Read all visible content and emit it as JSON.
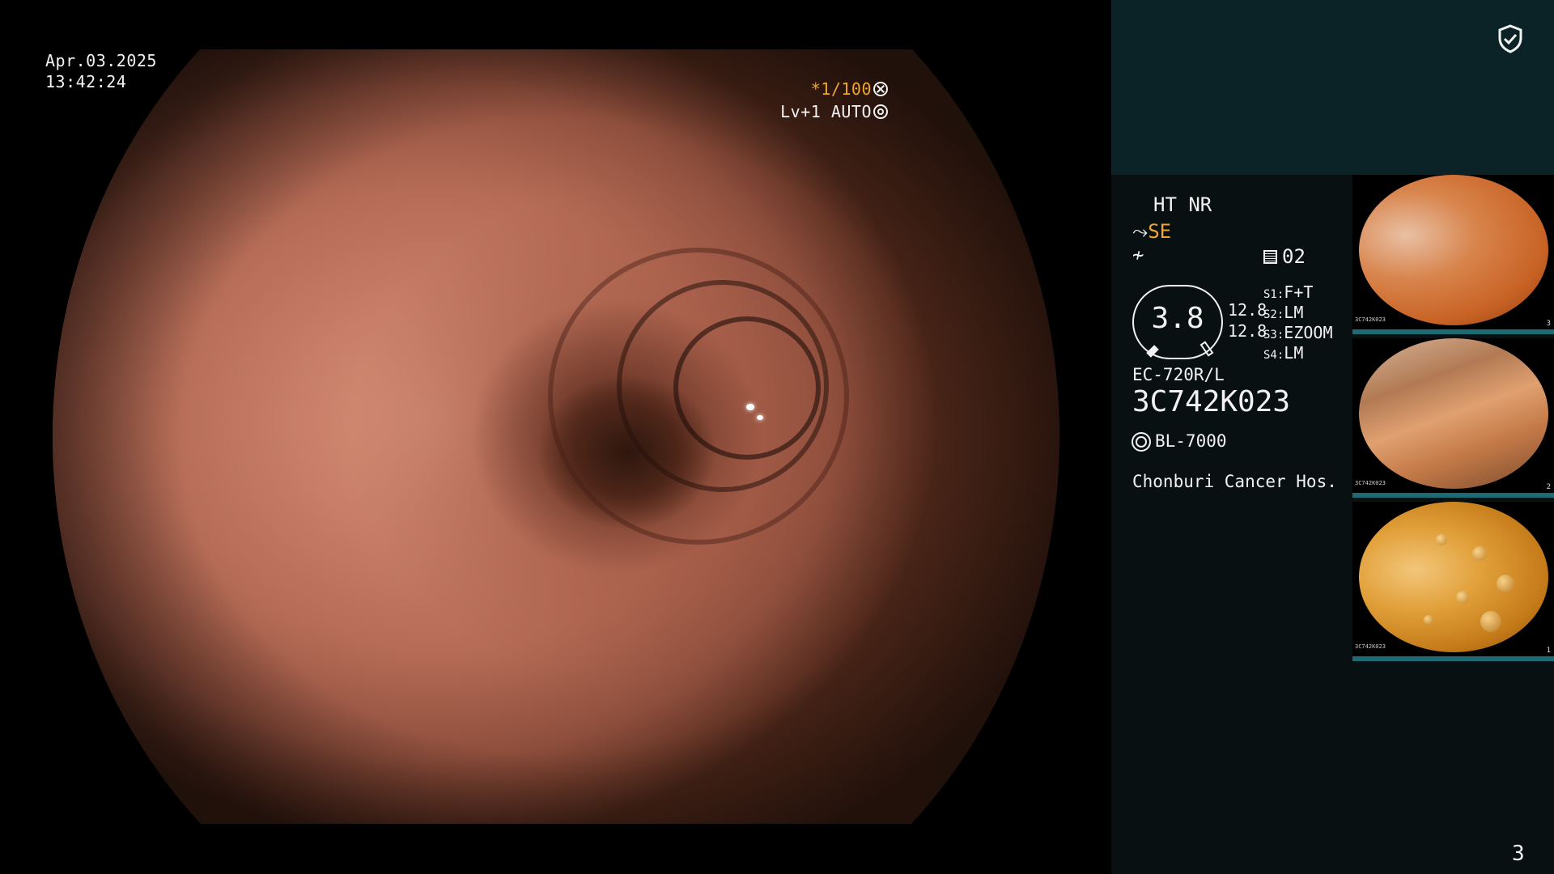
{
  "overlay": {
    "date": "Apr.03.2025",
    "time": "13:42:24",
    "shutter": "*1/100",
    "level": "Lv+1 AUTO"
  },
  "info": {
    "ht_nr": "HT NR",
    "se": "SE",
    "memory": "02",
    "gauge_value": "3.8",
    "gauge_line1": "12.8",
    "gauge_line2": "12.8",
    "switches": [
      {
        "key": "S1",
        "value": "F+T"
      },
      {
        "key": "S2",
        "value": "LM"
      },
      {
        "key": "S3",
        "value": "EZOOM"
      },
      {
        "key": "S4",
        "value": "LM"
      }
    ],
    "scope_model": "EC-720R/L",
    "scope_serial": "3C742K023",
    "light_source": "BL-7000",
    "hospital": "Chonburi Cancer Hos."
  },
  "thumbnails": [
    {
      "index": "3",
      "mini_serial": "3C742K023"
    },
    {
      "index": "2",
      "mini_serial": "3C742K023"
    },
    {
      "index": "1",
      "mini_serial": "3C742K023"
    }
  ],
  "page_number": "3",
  "colors": {
    "accent": "#f0a52c",
    "panel_top": "#0b2327",
    "panel": "#081012",
    "thumb_bar": "#1c6a74"
  },
  "icons": [
    "shield-check-icon",
    "shutter-icon",
    "iris-icon",
    "scope-icon",
    "memory-icon",
    "light-source-icon"
  ]
}
